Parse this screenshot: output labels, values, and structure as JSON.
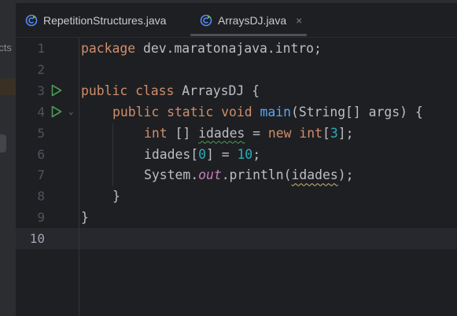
{
  "sidebar": {
    "partial_label": "ects"
  },
  "tabs": [
    {
      "label": "RepetitionStructures.java",
      "active": false
    },
    {
      "label": "ArraysDJ.java",
      "active": true,
      "close": "×"
    }
  ],
  "editor": {
    "current_line": 10,
    "lines": [
      {
        "n": "1",
        "indent": 0,
        "tokens": [
          [
            "kw",
            "package "
          ],
          [
            "",
            "dev.maratonajava.intro;"
          ]
        ]
      },
      {
        "n": "2",
        "indent": 0,
        "tokens": []
      },
      {
        "n": "3",
        "indent": 0,
        "run": true,
        "tokens": [
          [
            "kw",
            "public class "
          ],
          [
            "",
            "ArraysDJ {"
          ]
        ]
      },
      {
        "n": "4",
        "indent": 4,
        "run": true,
        "fold": true,
        "tokens": [
          [
            "kw",
            "public static void "
          ],
          [
            "fn",
            "main"
          ],
          [
            "",
            "(String[] args) {"
          ]
        ]
      },
      {
        "n": "5",
        "indent": 8,
        "tokens": [
          [
            "kw",
            "int "
          ],
          [
            "",
            "[] "
          ],
          [
            "warn2",
            "idades"
          ],
          [
            "",
            " = "
          ],
          [
            "kw",
            "new int"
          ],
          [
            "",
            "["
          ],
          [
            "num",
            "3"
          ],
          [
            "",
            "];"
          ]
        ]
      },
      {
        "n": "6",
        "indent": 8,
        "tokens": [
          [
            "",
            "idades["
          ],
          [
            "num",
            "0"
          ],
          [
            "",
            "] = "
          ],
          [
            "num",
            "10"
          ],
          [
            "",
            ";"
          ]
        ]
      },
      {
        "n": "7",
        "indent": 8,
        "tokens": [
          [
            "",
            "System."
          ],
          [
            "st",
            "out"
          ],
          [
            "",
            ".println("
          ],
          [
            "warn",
            "idades"
          ],
          [
            "",
            ");"
          ]
        ]
      },
      {
        "n": "8",
        "indent": 4,
        "tokens": [
          [
            "",
            "}"
          ]
        ]
      },
      {
        "n": "9",
        "indent": 0,
        "tokens": [
          [
            "",
            "}"
          ]
        ]
      },
      {
        "n": "10",
        "indent": 0,
        "tokens": []
      }
    ]
  },
  "colors": {
    "keyword": "#cf8e6d",
    "function": "#56a8f5",
    "number": "#2aacb8",
    "static": "#c77dbb",
    "run": "#499c54"
  }
}
